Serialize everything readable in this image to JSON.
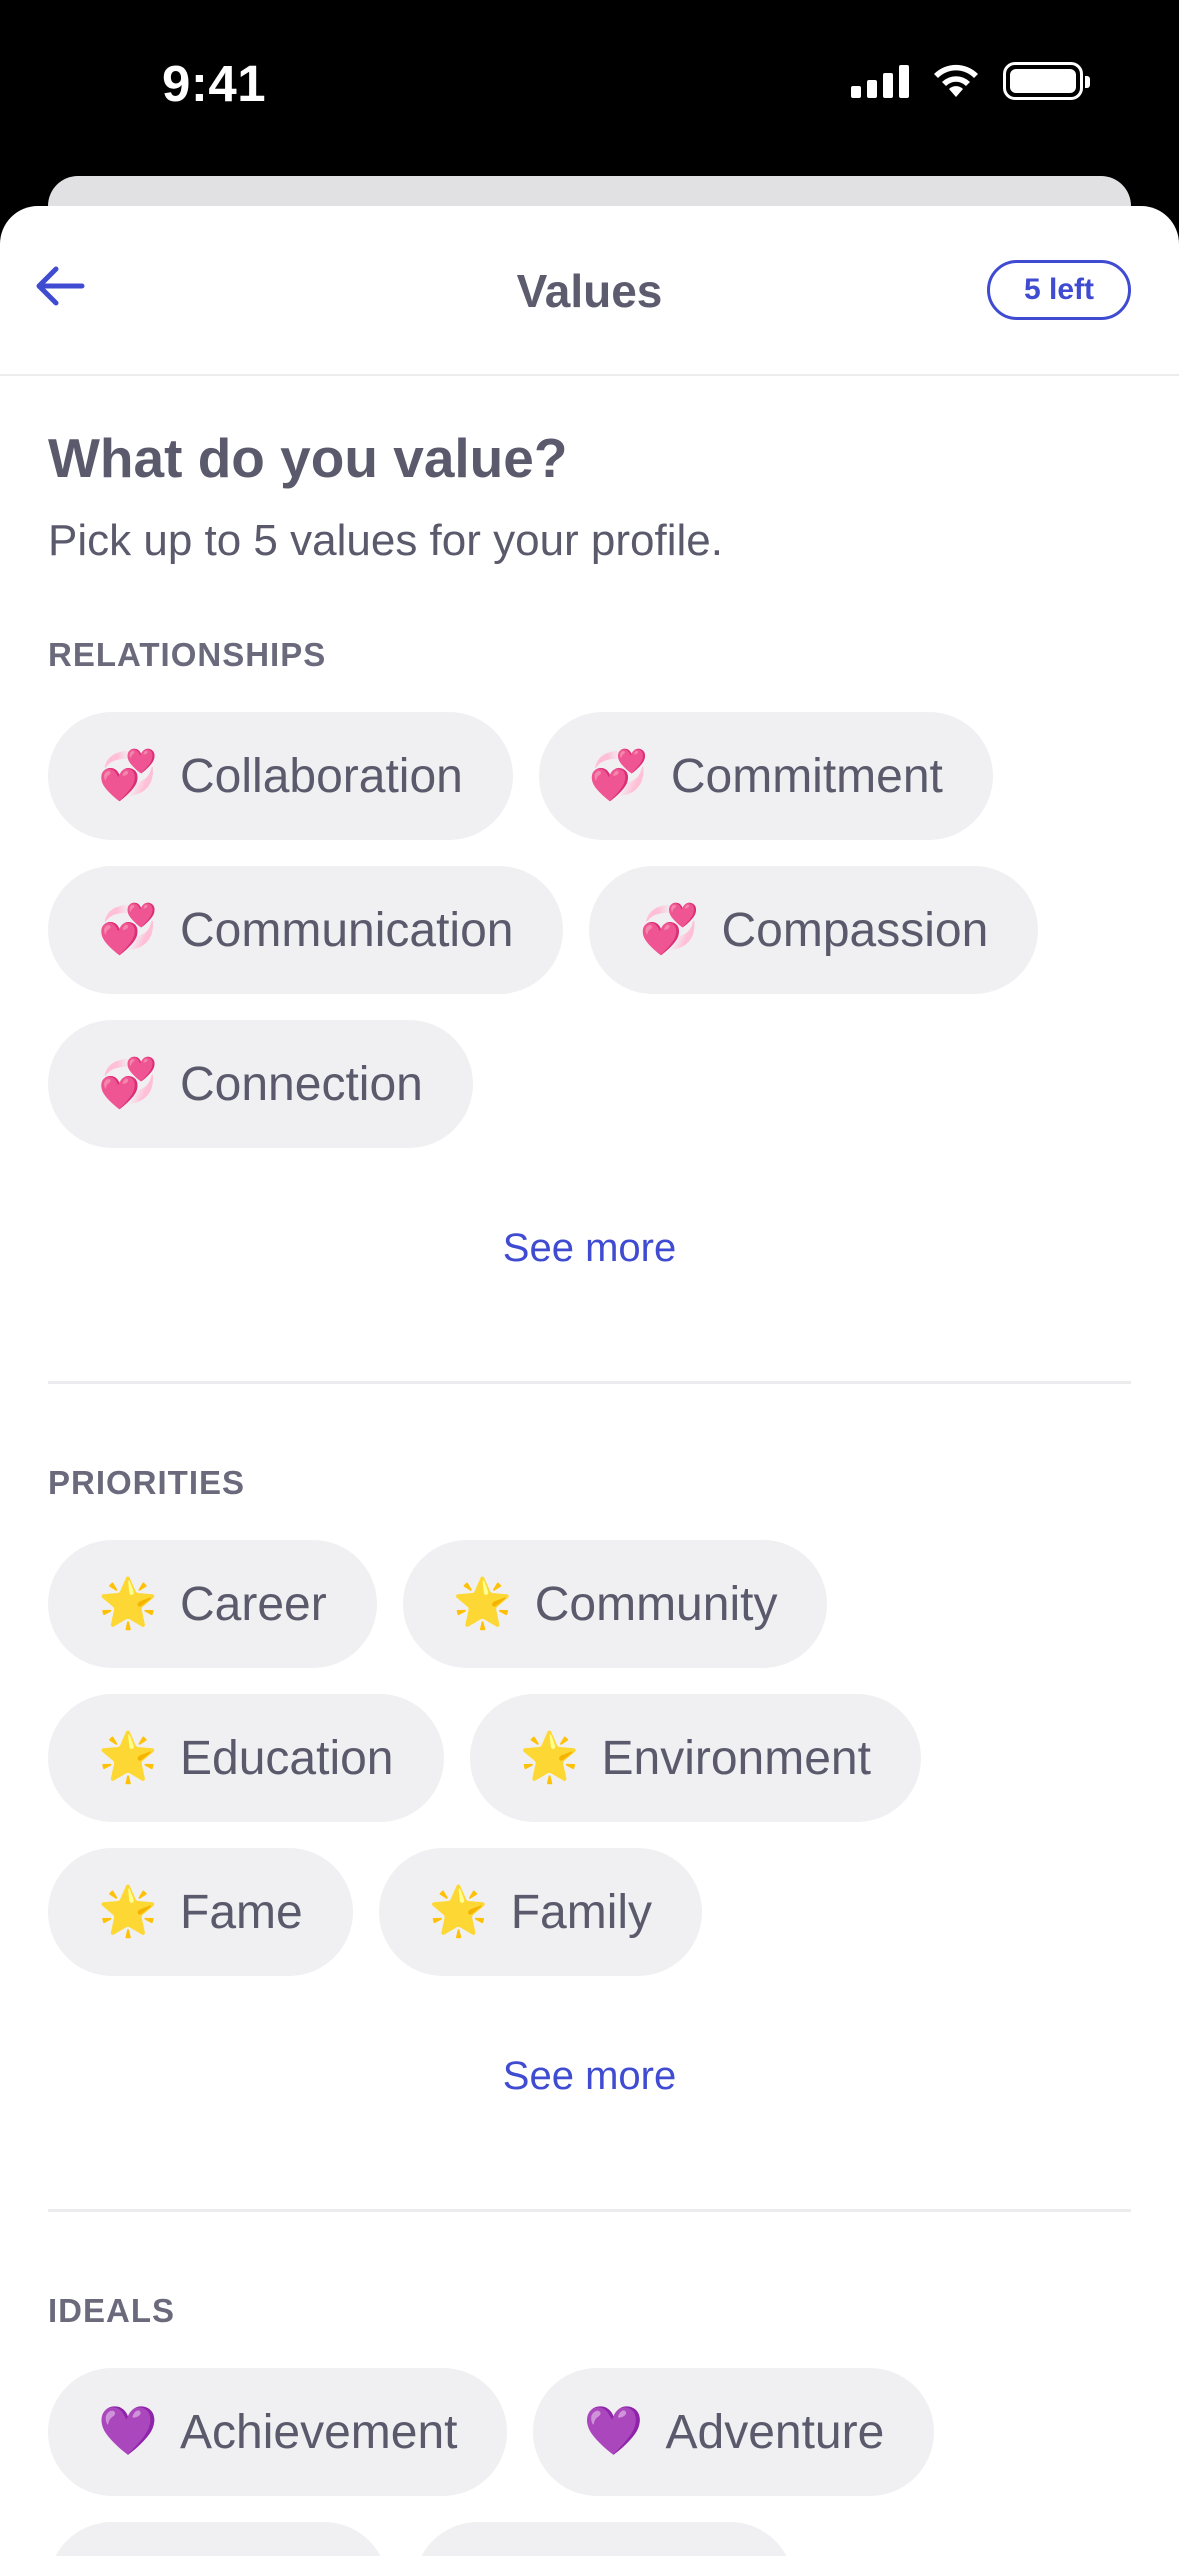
{
  "status_bar": {
    "time": "9:41"
  },
  "nav": {
    "title": "Values",
    "remaining_badge": "5 left"
  },
  "intro": {
    "heading": "What do you value?",
    "subheading": "Pick up to 5 values for your profile."
  },
  "sections": [
    {
      "title": "RELATIONSHIPS",
      "emoji": "💞",
      "chips": [
        "Collaboration",
        "Commitment",
        "Communication",
        "Compassion",
        "Connection"
      ],
      "see_more": "See more"
    },
    {
      "title": "PRIORITIES",
      "emoji": "🌟",
      "chips": [
        "Career",
        "Community",
        "Education",
        "Environment",
        "Fame",
        "Family"
      ],
      "see_more": "See more"
    },
    {
      "title": "IDEALS",
      "emoji": "💜",
      "chips": [
        "Achievement",
        "Adventure"
      ]
    }
  ],
  "colors": {
    "accent": "#3f4bd1",
    "chip_bg": "#f0f0f2",
    "text": "#5a5a6c"
  },
  "icons": {
    "back": "arrow-left-icon",
    "wifi": "wifi-icon",
    "signal": "cellular-signal-icon",
    "battery": "battery-icon"
  }
}
